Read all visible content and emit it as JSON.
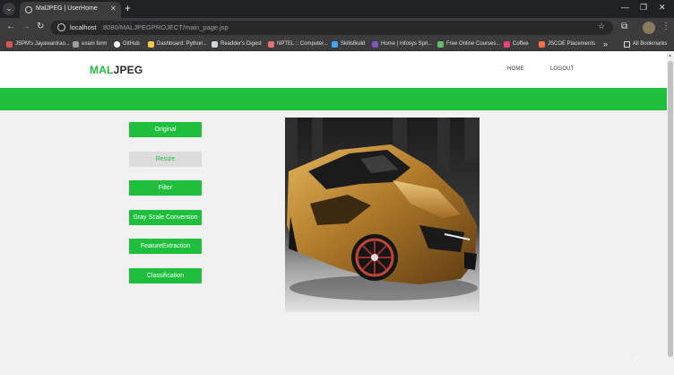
{
  "browser": {
    "tab_title": "MalJPEG | UserHome",
    "url_host": "localhost",
    "url_path": ":8080/MALJPEGPROJECT/main_page.jsp",
    "bookmarks": [
      {
        "label": "JSPM's Jayawantrao...",
        "icon": "globe-icon",
        "color": "#d9534f"
      },
      {
        "label": "exam form",
        "icon": "globe-icon",
        "color": "#9e9e9e"
      },
      {
        "label": "GitHub",
        "icon": "github-icon",
        "color": "#ffffff"
      },
      {
        "label": "Dashboard: Python...",
        "icon": "python-icon",
        "color": "#f2c94c"
      },
      {
        "label": "Readder's Digest",
        "icon": "book-icon",
        "color": "#cfd8dc"
      },
      {
        "label": "NPTEL :: Computer...",
        "icon": "nptel-icon",
        "color": "#e57373"
      },
      {
        "label": "SkillsBuild",
        "icon": "skillsbuild-icon",
        "color": "#42a5f5"
      },
      {
        "label": "Home | Infosys Spri...",
        "icon": "infosys-icon",
        "color": "#7e57c2"
      },
      {
        "label": "Free Online Courses...",
        "icon": "course-icon",
        "color": "#66bb6a"
      },
      {
        "label": "Coffee",
        "icon": "coffee-icon",
        "color": "#ec407a"
      },
      {
        "label": "JSCOE Placements",
        "icon": "placements-icon",
        "color": "#ff7043"
      }
    ],
    "overflow_label": "»",
    "all_bookmarks_label": "All Bookmarks"
  },
  "site": {
    "logo_part1": "MAL",
    "logo_part2": "JPEG",
    "nav": {
      "home": "HOME",
      "logout": "LOGOUT"
    },
    "accent_color": "#1fbf3d"
  },
  "sidebar": {
    "original": "Original",
    "resize": "Resize",
    "filter": "Filter",
    "grayscale": "Gray Scale Conversion",
    "feature": "FeatureExtraction",
    "classification": "Classification"
  },
  "image": {
    "subject": "gold sports car"
  }
}
